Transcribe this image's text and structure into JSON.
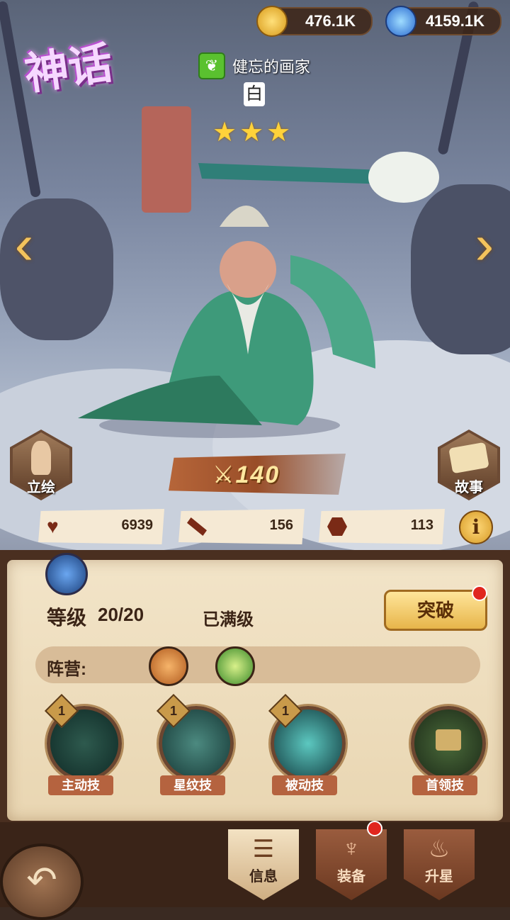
{
  "currencies": {
    "gold": {
      "value": "476.1K",
      "icon": "gold-coin-icon"
    },
    "gem": {
      "value": "4159.1K",
      "icon": "blue-potion-icon"
    }
  },
  "hero": {
    "rarity": "神话",
    "faction_icon": "nature-leaf-icon",
    "name": "健忘的画家",
    "sub_name": "白",
    "stars": 3,
    "power": "140"
  },
  "side_buttons": {
    "portrait": "立绘",
    "story": "故事"
  },
  "stats": {
    "hp": "6939",
    "attack": "156",
    "defense": "113"
  },
  "panel": {
    "level_label": "等级",
    "level_value": "20/20",
    "maxed_text": "已满级",
    "breakthrough_label": "突破",
    "camp_label": "阵营:"
  },
  "skills": [
    {
      "name": "主动技",
      "level": "1",
      "icon": "active-skill-flowers-icon",
      "locked": false
    },
    {
      "name": "星纹技",
      "level": "1",
      "icon": "star-skill-whale-icon",
      "locked": false
    },
    {
      "name": "被动技",
      "level": "1",
      "icon": "passive-skill-vortex-icon",
      "locked": false
    },
    {
      "name": "首领技",
      "level": "",
      "icon": "padlock-icon",
      "locked": true
    }
  ],
  "tabs": [
    {
      "label": "信息",
      "active": true,
      "icon": "info-wings-icon"
    },
    {
      "label": "装备",
      "active": false,
      "icon": "equipment-trident-icon",
      "badge": true
    },
    {
      "label": "升星",
      "active": false,
      "icon": "star-up-flame-icon"
    }
  ],
  "colors": {
    "accent_gold": "#f3c35c",
    "parchment": "#f2e4c8",
    "badge_red": "#e0261e"
  }
}
